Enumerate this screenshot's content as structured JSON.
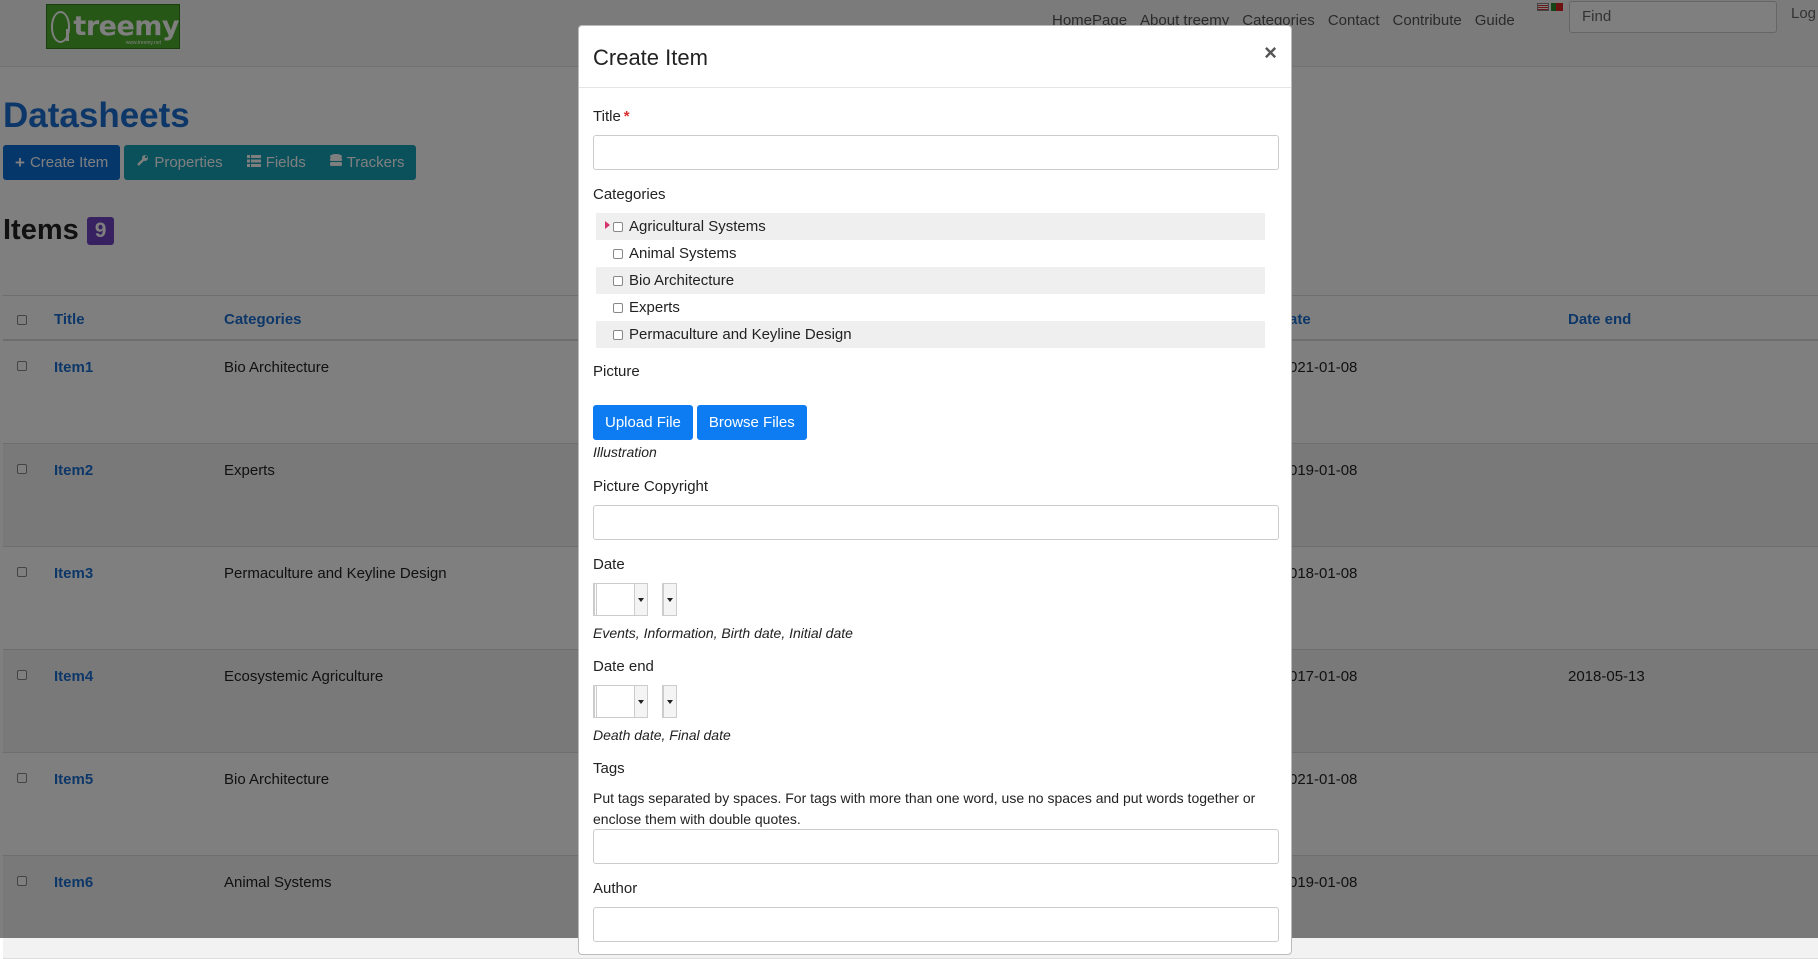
{
  "logo": {
    "text": "treemy",
    "sub": "www.treemy.net"
  },
  "nav": [
    "HomePage",
    "About treemy",
    "Categories",
    "Contact",
    "Contribute",
    "Guide"
  ],
  "search": {
    "placeholder": "Find"
  },
  "login": "Log",
  "page": {
    "title": "Datasheets",
    "toolbar": {
      "create": "Create Item",
      "properties": "Properties",
      "fields": "Fields",
      "trackers": "Trackers"
    },
    "items_label": "Items",
    "items_count": "9"
  },
  "table": {
    "headers": {
      "title": "Title",
      "categories": "Categories",
      "date": "ate",
      "date_end": "Date end"
    },
    "rows": [
      {
        "title": "Item1",
        "category": "Bio Architecture",
        "date": "021-01-08",
        "date_end": ""
      },
      {
        "title": "Item2",
        "category": "Experts",
        "date": "019-01-08",
        "date_end": ""
      },
      {
        "title": "Item3",
        "category": "Permaculture and Keyline Design",
        "date": "018-01-08",
        "date_end": ""
      },
      {
        "title": "Item4",
        "category": "Ecosystemic Agriculture",
        "date": "017-01-08",
        "date_end": "2018-05-13"
      },
      {
        "title": "Item5",
        "category": "Bio Architecture",
        "date": "021-01-08",
        "date_end": ""
      },
      {
        "title": "Item6",
        "category": "Animal Systems",
        "date": "019-01-08",
        "date_end": ""
      }
    ]
  },
  "modal": {
    "title": "Create Item",
    "close": "×",
    "title_label": "Title",
    "required_mark": "*",
    "categories_label": "Categories",
    "categories": [
      "Agricultural Systems",
      "Animal Systems",
      "Bio Architecture",
      "Experts",
      "Permaculture and Keyline Design"
    ],
    "picture_label": "Picture",
    "upload_button": "Upload File",
    "browse_button": "Browse Files",
    "picture_help": "Illustration",
    "copyright_label": "Picture Copyright",
    "date_label": "Date",
    "date_help": "Events, Information, Birth date, Initial date",
    "date_end_label": "Date end",
    "date_end_help": "Death date, Final date",
    "tags_label": "Tags",
    "tags_help": "Put tags separated by spaces. For tags with more than one word, use no spaces and put words together or enclose them with double quotes.",
    "author_label": "Author"
  },
  "colors": {
    "link": "#1a6fd1",
    "primary": "#0d7cf2",
    "info": "#17a2b8",
    "badge": "#6f42c1"
  },
  "icons": {
    "create": "plus-icon",
    "properties": "wrench-icon",
    "fields": "list-icon",
    "trackers": "database-icon",
    "close": "close-icon"
  }
}
